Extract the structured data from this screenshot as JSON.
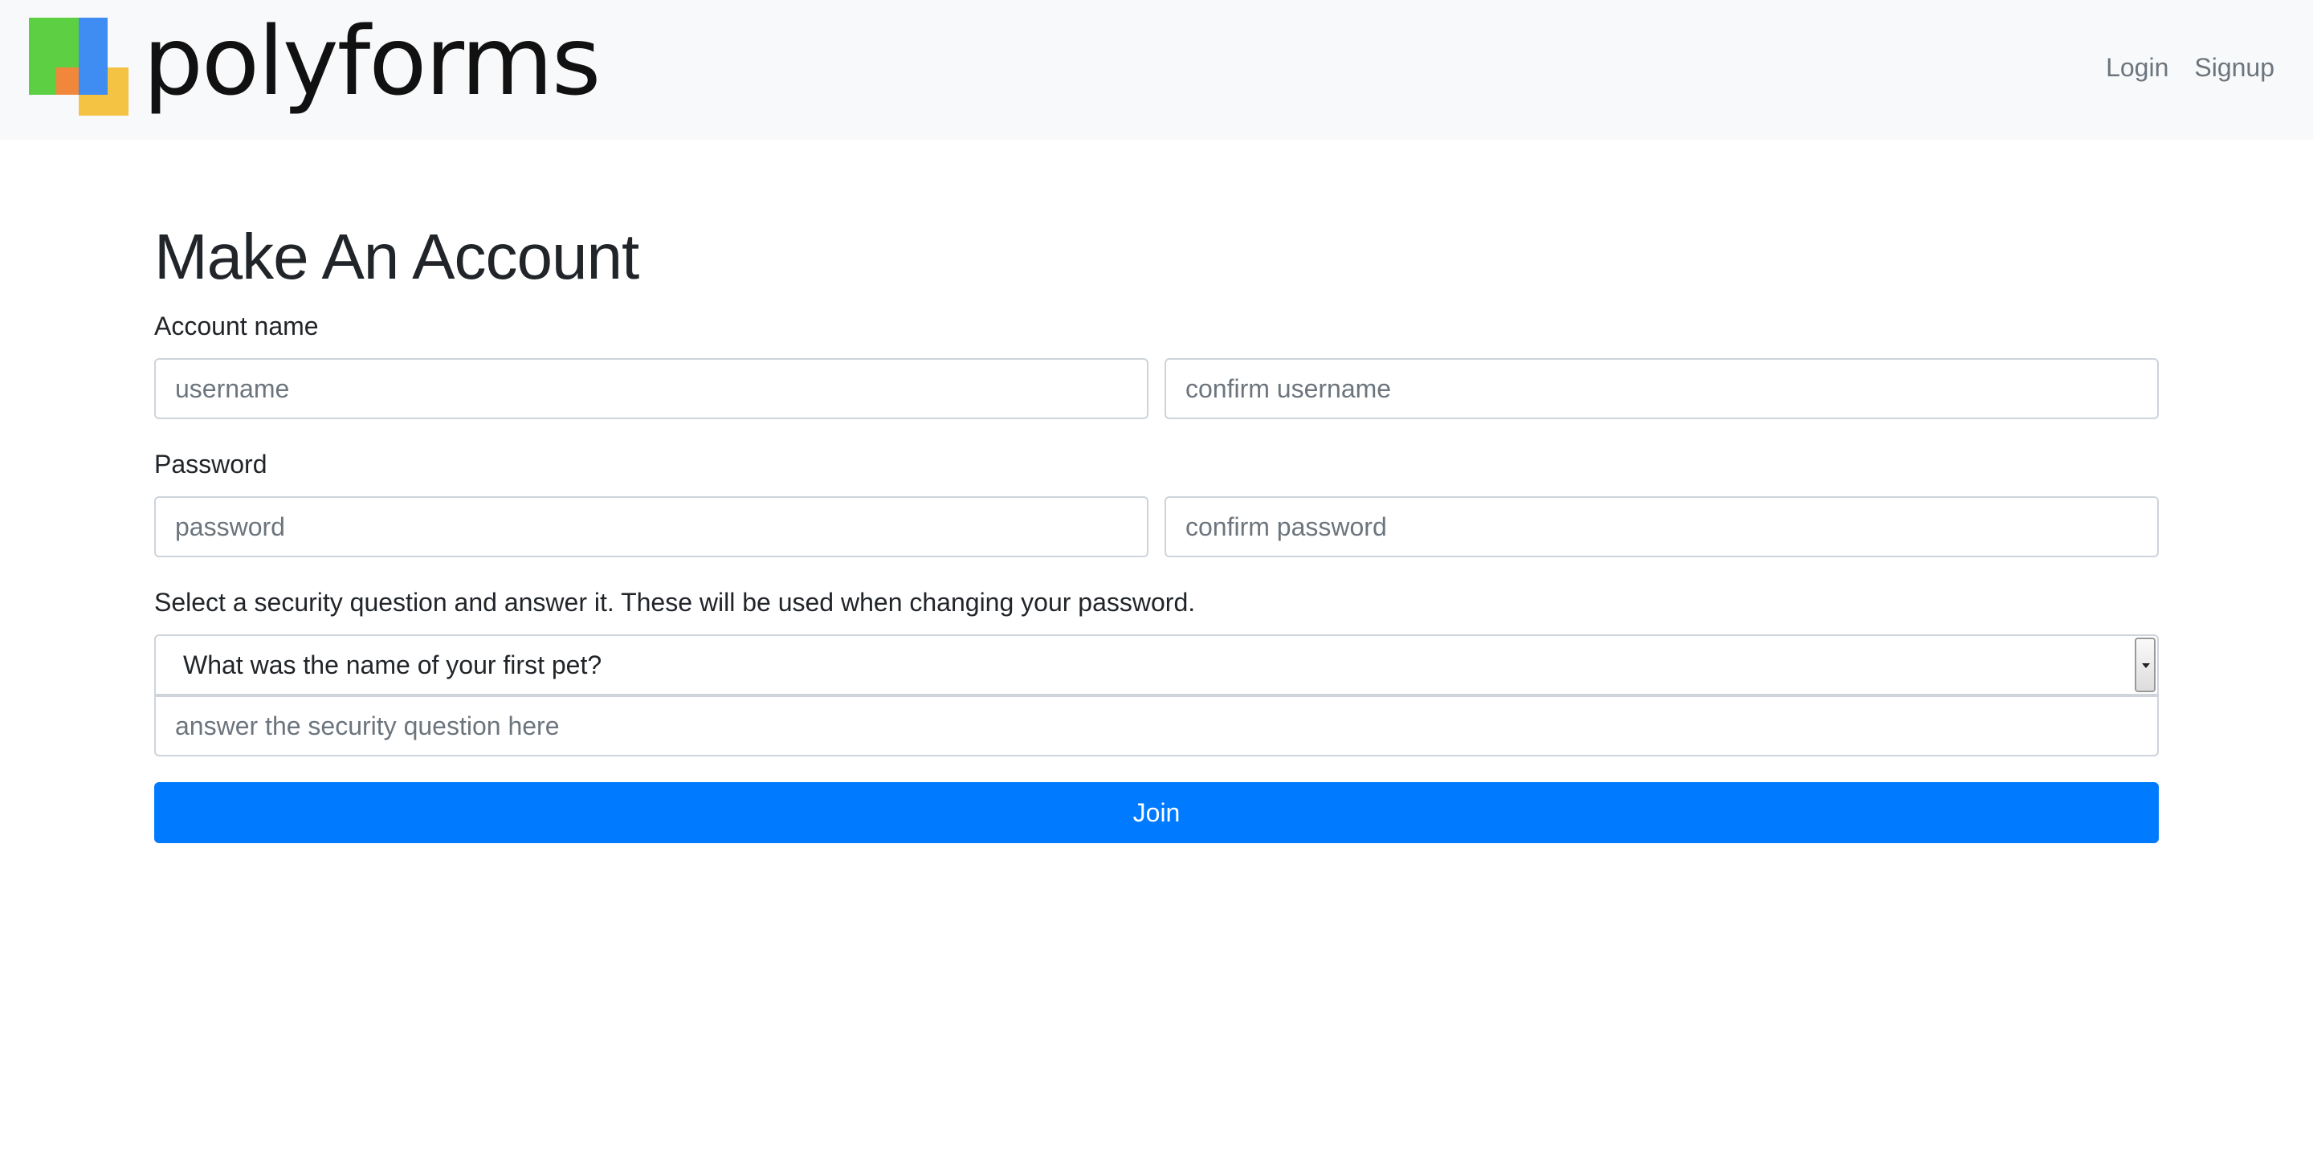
{
  "brand": {
    "name": "polyforms",
    "logo_colors": [
      "#5ccf42",
      "#3f8cf2",
      "#f0873a",
      "#f5c344"
    ]
  },
  "nav": {
    "login_label": "Login",
    "signup_label": "Signup"
  },
  "form": {
    "title": "Make An Account",
    "account_label": "Account name",
    "username_placeholder": "username",
    "confirm_username_placeholder": "confirm username",
    "password_label": "Password",
    "password_placeholder": "password",
    "confirm_password_placeholder": "confirm password",
    "security_label": "Select a security question and answer it. These will be used when changing your password.",
    "security_question_selected": "What was the name of your first pet?",
    "answer_placeholder": "answer the security question here",
    "submit_label": "Join"
  },
  "colors": {
    "primary": "#007bff",
    "navbar_bg": "#f8f9fa",
    "nav_link": "#6c757d"
  }
}
